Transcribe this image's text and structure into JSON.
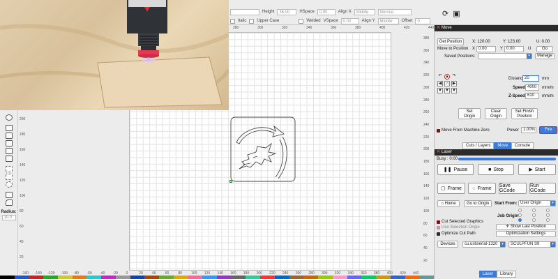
{
  "toolbar": {
    "height_label": "Height",
    "height_value": "36.00",
    "hspace_label": "HSpace",
    "hspace_value": "0.00",
    "align_x_label": "Align X",
    "align_x_value": "Middle",
    "normal_value": "Normal",
    "italic_label": "Italic",
    "upper_case_label": "Upper Case",
    "welded_label": "Welded",
    "vspace_label": "VSpace",
    "vspace_value": "0.00",
    "align_y_label": "Align Y",
    "align_y_value": "Middle",
    "offset_label": "Offset",
    "offset_value": "0"
  },
  "left_tools": {
    "radius_label": "Radius:",
    "radius_value": "10.0"
  },
  "rulers": {
    "top": [
      "280",
      "300",
      "320",
      "340",
      "360",
      "380",
      "400",
      "420",
      "440"
    ],
    "bottom": [
      "-160",
      "-140",
      "-120",
      "-100",
      "-80",
      "-60",
      "-40",
      "-20",
      "0",
      "20",
      "40",
      "60",
      "80",
      "100",
      "120",
      "140",
      "160",
      "180",
      "200",
      "220",
      "240",
      "260",
      "280",
      "300",
      "320",
      "340",
      "360",
      "380",
      "400",
      "420",
      "440"
    ],
    "right": [
      "380",
      "360",
      "340",
      "320",
      "300",
      "280",
      "260",
      "240",
      "220",
      "200",
      "180",
      "160",
      "140",
      "120",
      "100",
      "80",
      "60",
      "40",
      "20"
    ],
    "left": [
      "200",
      "180",
      "160",
      "140",
      "120",
      "100",
      "80",
      "60",
      "40",
      "20"
    ]
  },
  "move_panel": {
    "title": "Move",
    "get_position": "Get Position",
    "x_label": "X:",
    "x_value": "120.00",
    "y_label": "Y:",
    "y_value": "123.00",
    "u_label": "U:",
    "u_value": "0.00",
    "move_to_position": "Move to Position",
    "move_x_label": "X",
    "move_x_value": "0.00",
    "move_y_label": "Y",
    "move_y_value": "0.00",
    "move_u_label": "U",
    "move_u_value": "0.00",
    "go": "Go",
    "saved_positions": "Saved Positions:",
    "manage": "Manage",
    "distance_label": "Distance",
    "distance_value": "20",
    "distance_unit": "mm",
    "speed_label": "Speed",
    "speed_value": "4000",
    "speed_unit": "mm/m",
    "zspeed_label": "Z-Speed",
    "zspeed_value": "610",
    "zspeed_unit": "mm/m",
    "set_origin": [
      "Set",
      "Origin"
    ],
    "clear_origin": [
      "Clear",
      "Origin"
    ],
    "set_finish": [
      "Set Finish",
      "Position"
    ],
    "move_from_zero": "Move From Machine Zero",
    "power_label": "Power",
    "power_value": "1.00%",
    "fire": "Fire"
  },
  "tabs": [
    "Cuts / Layers",
    "Move",
    "Console"
  ],
  "active_tab": "Move",
  "laser_panel": {
    "title": "Laser",
    "busy": "Busy : 0:00",
    "progress": 1.0,
    "pause": "Pause",
    "stop": "Stop",
    "start": "Start",
    "frame1": "Frame",
    "frame2": "Frame",
    "save_gcode": "Save GCode",
    "run_gcode": "Run GCode",
    "home": "Home",
    "go_to_origin": "Go to Origin",
    "start_from_label": "Start From:",
    "start_from_value": "User Origin",
    "job_origin_label": "Job Origin",
    "cut_selected": "Cut Selected Graphics",
    "use_selection_origin": "Use Selection Origin",
    "optimize_cut_path": "Optimize Cut Path",
    "show_last_position": "Show Last Position",
    "optimization_settings": "Optimization Settings",
    "devices": "Devices",
    "port_value": "cu.usbserial-1320",
    "device_value": "SCULPFUN S9"
  },
  "bottom_tabs": [
    "Laser",
    "Library"
  ],
  "active_bottom_tab": "Laser",
  "colors": {
    "accent": "#3b7bd9",
    "fire_border": "#d62828"
  }
}
